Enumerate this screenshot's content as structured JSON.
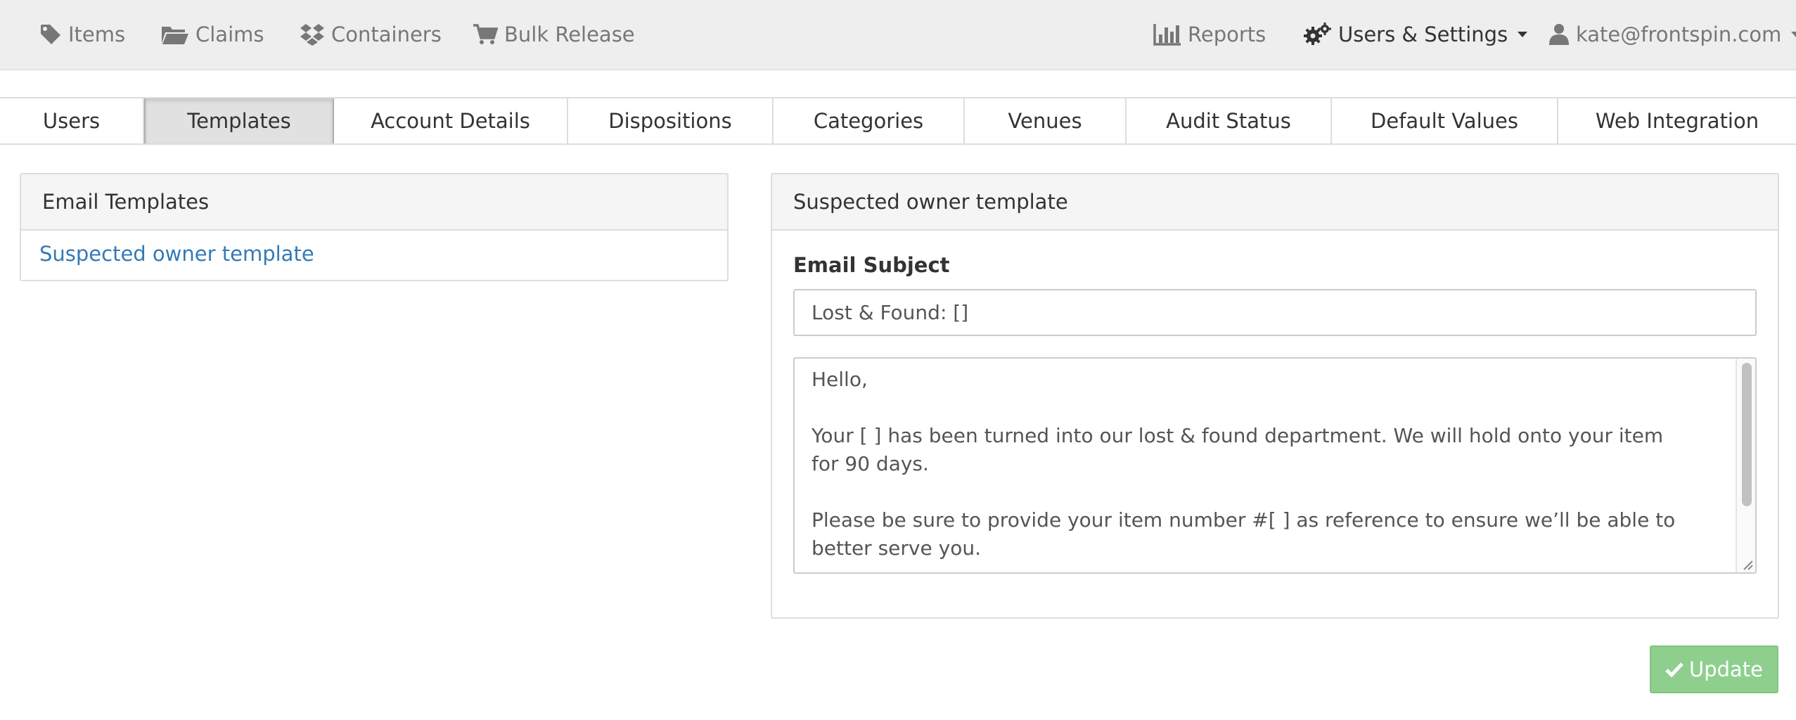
{
  "navbar": {
    "items": [
      {
        "label": "Items",
        "icon": "tag-icon"
      },
      {
        "label": "Claims",
        "icon": "folder-open-icon"
      },
      {
        "label": "Containers",
        "icon": "dropbox-icon"
      },
      {
        "label": "Bulk Release",
        "icon": "shopping-cart-icon"
      }
    ],
    "reports": {
      "label": "Reports",
      "icon": "bar-chart-icon"
    },
    "settings": {
      "label": "Users & Settings",
      "icon": "gears-icon"
    },
    "user": {
      "label": "kate@frontspin.com",
      "icon": "user-icon"
    }
  },
  "tabs": [
    {
      "label": "Users",
      "active": false
    },
    {
      "label": "Templates",
      "active": true
    },
    {
      "label": "Account Details",
      "active": false
    },
    {
      "label": "Dispositions",
      "active": false
    },
    {
      "label": "Categories",
      "active": false
    },
    {
      "label": "Venues",
      "active": false
    },
    {
      "label": "Audit Status",
      "active": false
    },
    {
      "label": "Default Values",
      "active": false
    },
    {
      "label": "Web Integration",
      "active": false
    }
  ],
  "templates_panel": {
    "heading": "Email Templates",
    "items": [
      "Suspected owner template"
    ]
  },
  "editor_panel": {
    "heading": "Suspected owner template",
    "subject_label": "Email Subject",
    "subject_value": "Lost & Found: []",
    "body": "Hello,\n\nYour [ ] has been turned into our lost & found department. We will hold onto your item for 90 days.\n\nPlease be sure to provide your item number #[ ] as reference to ensure we’ll be able to better serve you."
  },
  "update_button": {
    "label": "Update",
    "icon": "check-icon"
  },
  "colors": {
    "navbar_bg": "#eeeeee",
    "link": "#337ab7",
    "success": "#8ecf8e",
    "muted_text": "#777777"
  }
}
